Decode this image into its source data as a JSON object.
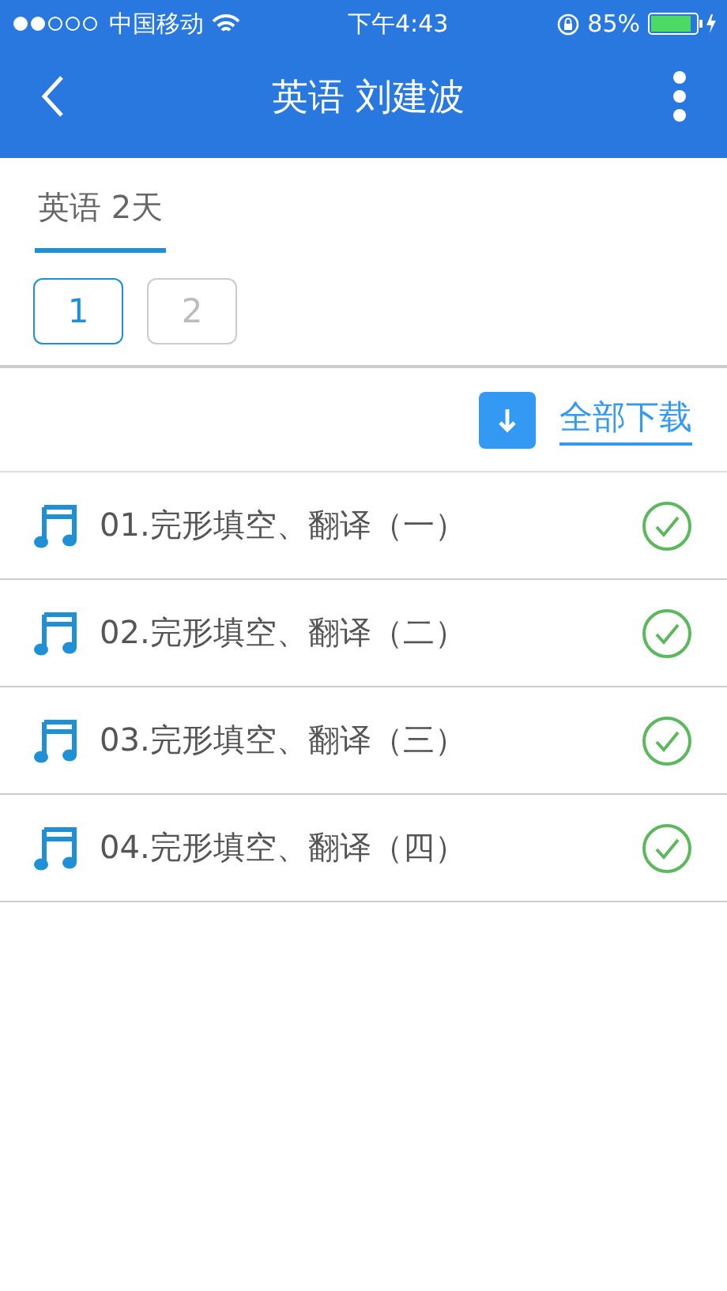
{
  "status_bar": {
    "carrier": "中国移动",
    "time": "下午4:43",
    "battery": "85%"
  },
  "nav": {
    "title": "英语 刘建波"
  },
  "tabs": [
    {
      "label": "英语 2天",
      "selected": true
    }
  ],
  "pages": [
    {
      "label": "1",
      "selected": true
    },
    {
      "label": "2",
      "selected": false
    }
  ],
  "download_all": {
    "label": "全部下载"
  },
  "tracks": [
    {
      "title": "01.完形填空、翻译（一）",
      "downloaded": true
    },
    {
      "title": "02.完形填空、翻译（二）",
      "downloaded": true
    },
    {
      "title": "03.完形填空、翻译（三）",
      "downloaded": true
    },
    {
      "title": "04.完形填空、翻译（四）",
      "downloaded": true
    }
  ]
}
